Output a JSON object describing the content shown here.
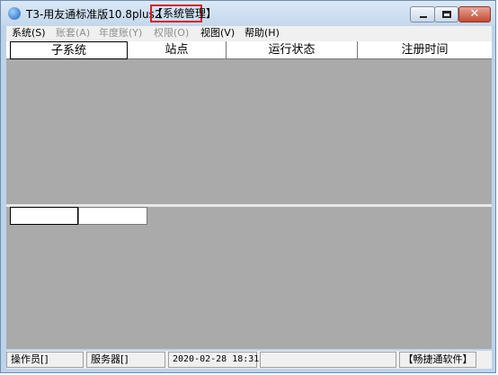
{
  "window": {
    "title": "T3-用友通标准版10.8plus2",
    "title_highlight": "【系统管理】"
  },
  "menu": [
    {
      "label": "系统(S)",
      "enabled": true
    },
    {
      "label": "账套(A)",
      "enabled": false
    },
    {
      "label": "年度账(Y)",
      "enabled": false
    },
    {
      "label": "权限(O)",
      "enabled": false
    },
    {
      "label": "视图(V)",
      "enabled": true
    },
    {
      "label": "帮助(H)",
      "enabled": true
    }
  ],
  "table": {
    "columns": [
      "子系统",
      "站点",
      "运行状态",
      "注册时间"
    ]
  },
  "status": {
    "operator": "操作员[]",
    "server": "服务器[]",
    "datetime": "2020-02-28 18:31",
    "empty": "",
    "brand": "【畅捷通软件】"
  }
}
